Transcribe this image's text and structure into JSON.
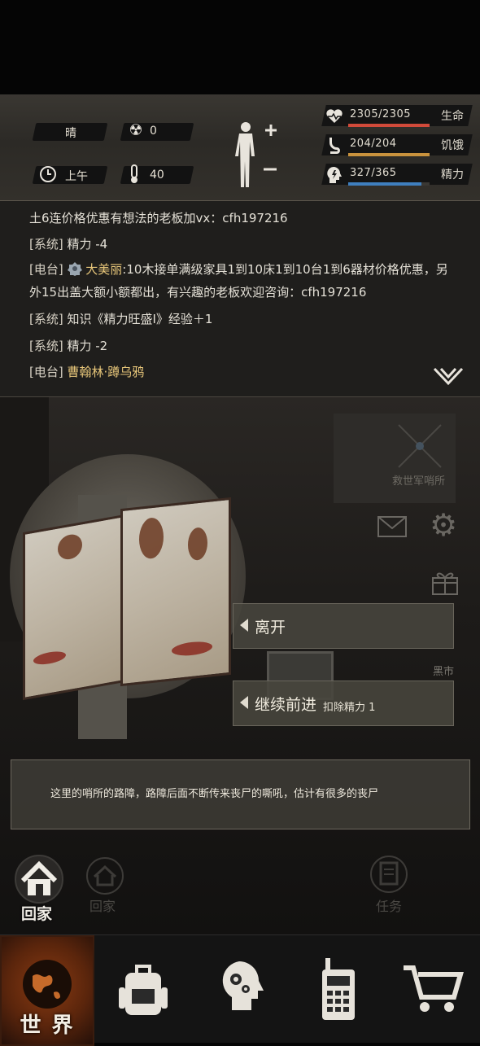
{
  "status": {
    "weather": "晴",
    "radiation": "0",
    "time_of_day": "上午",
    "temperature": "40",
    "health": {
      "value": "2305/2305",
      "label": "生命",
      "fraction": 1.0,
      "color": "#d14a3a"
    },
    "hunger": {
      "value": "204/204",
      "label": "饥饿",
      "fraction": 1.0,
      "color": "#c9923d"
    },
    "energy": {
      "value": "327/365",
      "label": "精力",
      "fraction": 0.896,
      "color": "#3f7fbf"
    }
  },
  "log": {
    "lines": [
      {
        "text": "土6连价格优惠有想法的老板加vx：cfh197216"
      },
      {
        "tag": "[系统]",
        "text": "精力 -4"
      },
      {
        "tag": "[电台]",
        "name": "大美丽",
        "text": ":10木接单满级家具1到10床1到10台1到6器材价格优惠，另"
      },
      {
        "text": "外15出盖大额小额都出，有兴趣的老板欢迎咨询：cfh197216"
      },
      {
        "tag": "[系统]",
        "text": "知识《精力旺盛Ⅰ》经验＋1"
      },
      {
        "tag": "[系统]",
        "text": "精力 -2"
      },
      {
        "tag": "[电台]",
        "name": "曹翰林",
        "text": "·蹲乌鸦"
      }
    ]
  },
  "scene": {
    "location_label": "救世军哨所",
    "market_label": "黑市",
    "options": [
      {
        "label": "离开",
        "sub": ""
      },
      {
        "label": "继续前进",
        "sub": "扣除精力 1"
      }
    ],
    "description": "这里的哨所的路障，路障后面不断传来丧尸的嘶吼，估计有很多的丧尸",
    "home_label": "回家",
    "home_label_faded": "回家",
    "task_label": "任务"
  },
  "nav": {
    "world_label": "世 界",
    "items": [
      "world-icon",
      "backpack-icon",
      "skills-head-icon",
      "radio-icon",
      "cart-icon"
    ]
  }
}
